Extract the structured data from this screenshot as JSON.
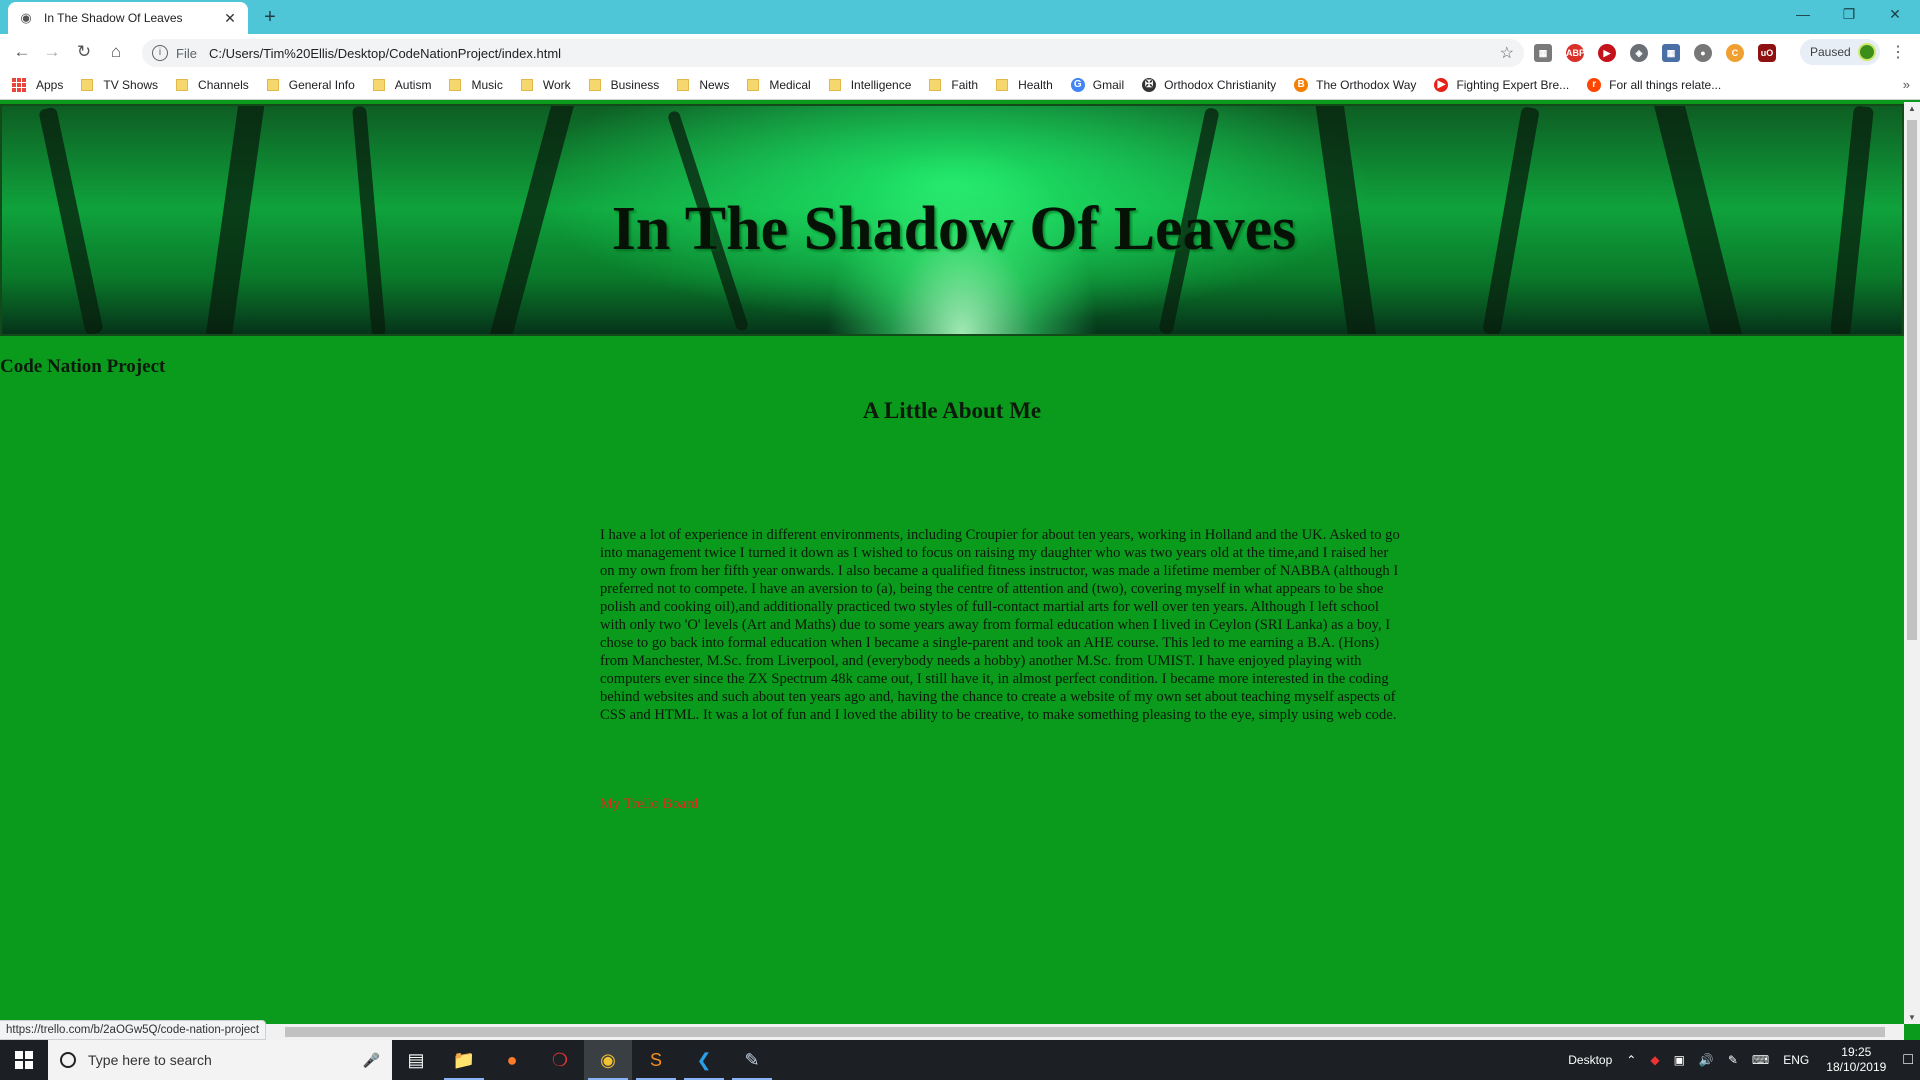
{
  "browser": {
    "tab_title": "In The Shadow Of Leaves",
    "new_tab": "+",
    "url_scheme": "File",
    "url": "C:/Users/Tim%20Ellis/Desktop/CodeNationProject/index.html",
    "profile_status": "Paused",
    "status_bar_url": "https://trello.com/b/2aOGw5Q/code-nation-project"
  },
  "bookmarks": [
    {
      "label": "Apps",
      "icon": "apps-grid-icon"
    },
    {
      "label": "TV Shows",
      "icon": "folder-icon"
    },
    {
      "label": "Channels",
      "icon": "folder-icon"
    },
    {
      "label": "General Info",
      "icon": "folder-icon"
    },
    {
      "label": "Autism",
      "icon": "folder-icon"
    },
    {
      "label": "Music",
      "icon": "folder-icon"
    },
    {
      "label": "Work",
      "icon": "folder-icon"
    },
    {
      "label": "Business",
      "icon": "folder-icon"
    },
    {
      "label": "News",
      "icon": "folder-icon"
    },
    {
      "label": "Medical",
      "icon": "folder-icon"
    },
    {
      "label": "Intelligence",
      "icon": "folder-icon"
    },
    {
      "label": "Faith",
      "icon": "folder-icon"
    },
    {
      "label": "Health",
      "icon": "folder-icon"
    },
    {
      "label": "Gmail",
      "icon": "google-icon"
    },
    {
      "label": "Orthodox Christianity",
      "icon": "orthodox-icon"
    },
    {
      "label": "The Orthodox Way",
      "icon": "blogger-icon"
    },
    {
      "label": "Fighting Expert Bre...",
      "icon": "youtube-icon"
    },
    {
      "label": "For all things relate...",
      "icon": "reddit-icon"
    }
  ],
  "page": {
    "hero_title": "In The Shadow Of Leaves",
    "site_name": "Code Nation Project",
    "about_heading": "A Little About Me",
    "bio": "I have a lot of experience in different environments, including Croupier for about ten years, working in Holland and the UK. Asked to go into management twice I turned it down as I wished to focus on raising my daughter who was two years old at the time,and I raised her on my own from her fifth year onwards. I also became a qualified fitness instructor, was made a lifetime member of NABBA (although I preferred not to compete. I have an aversion to (a), being the centre of attention and (two), covering myself in what appears to be shoe polish and cooking oil),and additionally practiced two styles of full-contact martial arts for well over ten years. Although I left school with only two 'O' levels (Art and Maths) due to some years away from formal education when I lived in Ceylon (SRI Lanka) as a boy, I chose to go back into formal education when I became a single-parent and took an AHE course. This led to me earning a B.A. (Hons) from Manchester, M.Sc. from Liverpool, and (everybody needs a hobby) another M.Sc. from UMIST. I have enjoyed playing with computers ever since the ZX Spectrum 48k came out, I still have it, in almost perfect condition. I became more interested in the coding behind websites and such about ten years ago and, having the chance to create a website of my own set about teaching myself aspects of CSS and HTML. It was a lot of fun and I loved the ability to be creative, to make something pleasing to the eye, simply using web code.",
    "trello_link": "My Trello Board",
    "background_color": "#0a9b1c",
    "link_color": "#e0281a"
  },
  "taskbar": {
    "search_placeholder": "Type here to search",
    "desktop_label": "Desktop",
    "language": "ENG",
    "time": "19:25",
    "date": "18/10/2019"
  }
}
